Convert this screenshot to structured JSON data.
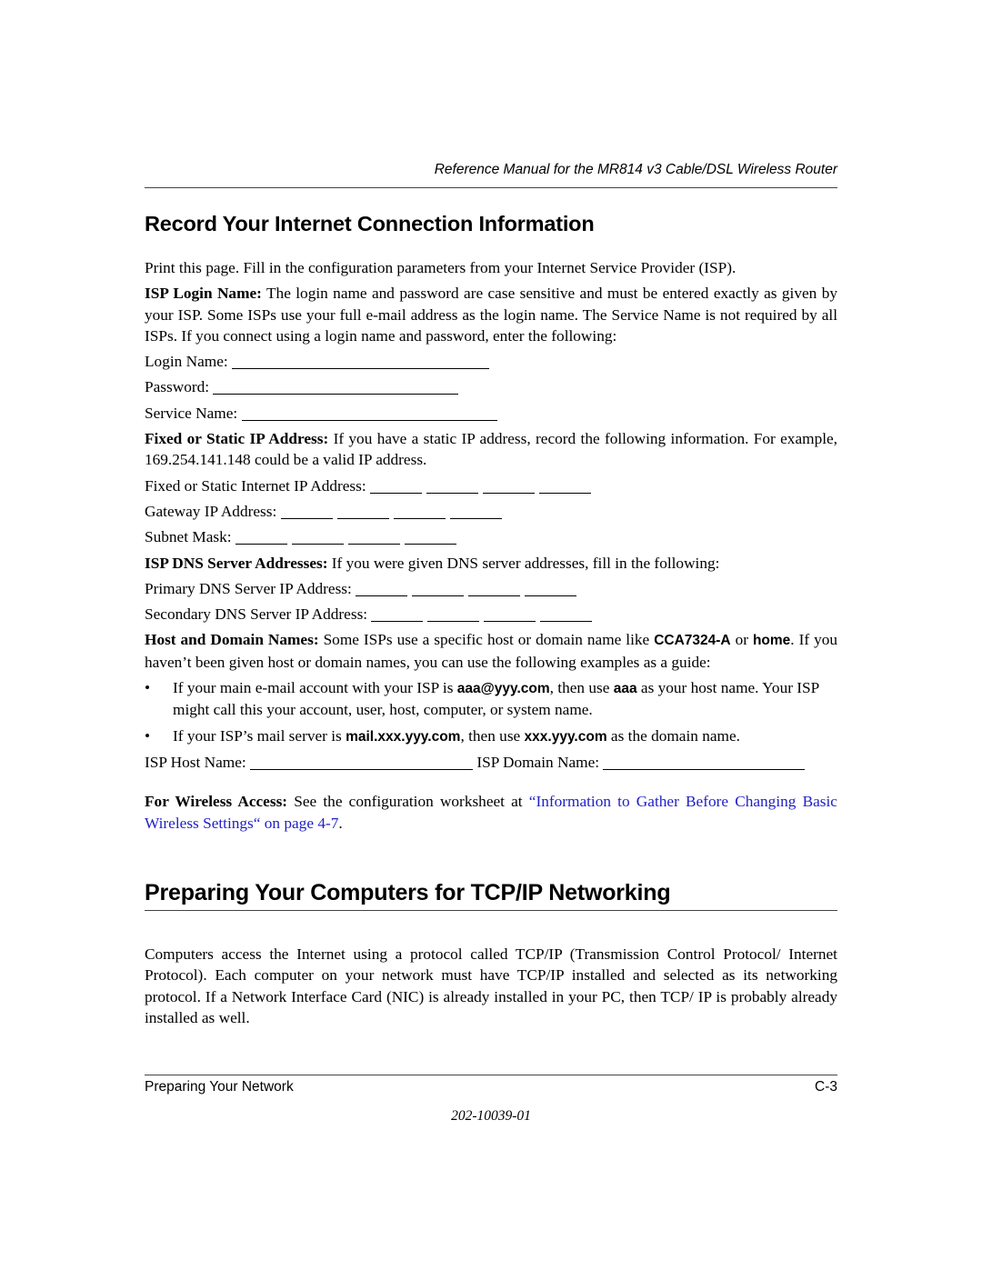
{
  "header": {
    "running_title": "Reference Manual for the MR814 v3 Cable/DSL Wireless Router"
  },
  "section1": {
    "title": "Record Your Internet Connection Information",
    "intro": "Print this page. Fill in the configuration parameters from your Internet Service Provider (ISP).",
    "login": {
      "label": "ISP Login Name:",
      "text": " The login name and password are case sensitive and must be entered exactly as given by your ISP. Some ISPs use your full e-mail address as the login name. The Service Name is not required by all ISPs. If you connect using a login name and password, enter the following:"
    },
    "login_fields": {
      "login_name": "Login Name:",
      "password": "Password:",
      "service_name": "Service Name:"
    },
    "static": {
      "label": "Fixed or Static IP Address:",
      "text": " If you have a static IP address, record the following information. For example, 169.254.141.148 could be a valid IP address."
    },
    "static_fields": {
      "ip": "Fixed or Static Internet IP Address:",
      "gateway": "Gateway IP Address:",
      "subnet": "Subnet Mask:"
    },
    "dns": {
      "label": "ISP DNS Server Addresses:",
      "text": " If you were given DNS server addresses, fill in the following:"
    },
    "dns_fields": {
      "primary": "Primary DNS Server IP Address:",
      "secondary": "Secondary DNS Server IP Address:"
    },
    "host": {
      "label": "Host and Domain Names:",
      "text1": " Some ISPs use a specific host or domain name like ",
      "code1": "CCA7324-A",
      "text2": " or ",
      "code2": "home",
      "text3": ". If you haven’t been given host or domain names, you can use the following examples as a guide:"
    },
    "bullets": [
      {
        "t1": "If your main e-mail account with your ISP is ",
        "c1": "aaa@yyy.com",
        "t2": ", then use ",
        "c2": "aaa",
        "t3": " as your host name. Your ISP might call this your account, user, host, computer, or system name."
      },
      {
        "t1": "If your ISP’s mail server is ",
        "c1": "mail.xxx.yyy.com",
        "t2": ", then use ",
        "c2": "xxx.yyy.com",
        "t3": " as the domain name."
      }
    ],
    "host_fields": {
      "host": "ISP Host Name:",
      "domain": "ISP Domain Name:"
    },
    "wireless": {
      "label": "For Wireless Access:",
      "text": " See the configuration worksheet at ",
      "link": "“Information to Gather Before Changing Basic Wireless Settings“ on page 4-7",
      "end": "."
    }
  },
  "section2": {
    "title": "Preparing Your Computers for TCP/IP Networking",
    "body": "Computers access the Internet using a protocol called TCP/IP (Transmission Control Protocol/ Internet Protocol). Each computer on your network must have TCP/IP installed and selected as its networking protocol. If a Network Interface Card (NIC) is already installed in your PC, then TCP/ IP is probably already installed as well."
  },
  "footer": {
    "chapter": "Preparing Your Network",
    "page": "C-3",
    "doc_number": "202-10039-01"
  }
}
